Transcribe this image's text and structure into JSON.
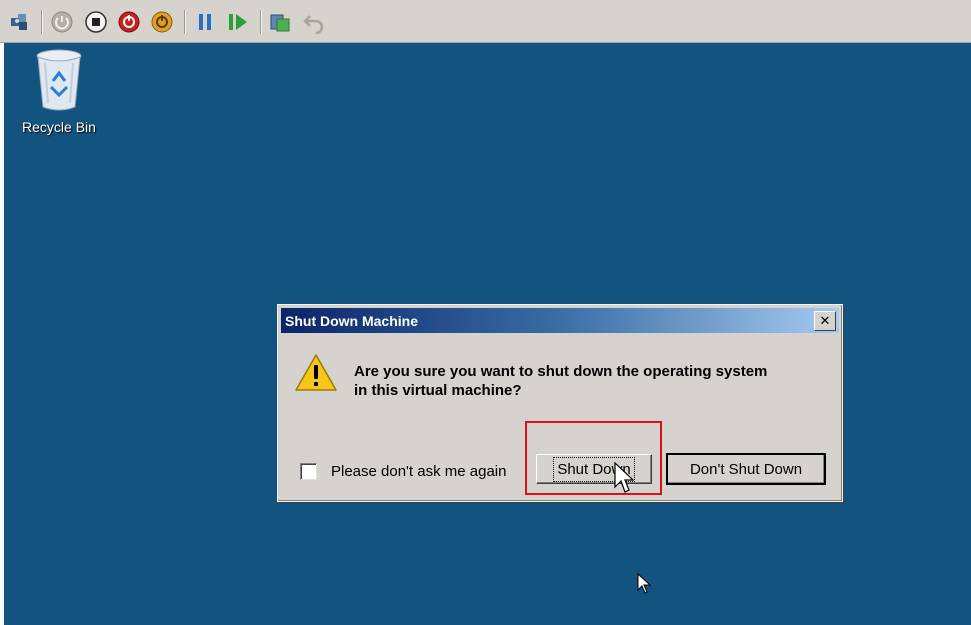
{
  "toolbar": {
    "buttons": [
      {
        "name": "ctrl-alt-del-icon"
      },
      {
        "name": "start-icon"
      },
      {
        "name": "turn-off-icon"
      },
      {
        "name": "shutdown-icon"
      },
      {
        "name": "save-state-icon"
      },
      {
        "name": "pause-icon"
      },
      {
        "name": "resume-icon"
      },
      {
        "name": "snapshot-icon"
      },
      {
        "name": "revert-icon"
      }
    ]
  },
  "desktop": {
    "background": "#135380",
    "recycle_bin_label": "Recycle Bin"
  },
  "dialog": {
    "title": "Shut Down Machine",
    "message_line1": "Are you sure you want to shut down the operating system",
    "message_line2": "in this virtual machine?",
    "checkbox_label": "Please don't ask me again",
    "shutdown_button": "Shut Down",
    "dont_shutdown_button": "Don't Shut Down",
    "close_glyph": "✕"
  },
  "colors": {
    "highlight": "#e0101a",
    "title_gradient_start": "#0a246a"
  }
}
